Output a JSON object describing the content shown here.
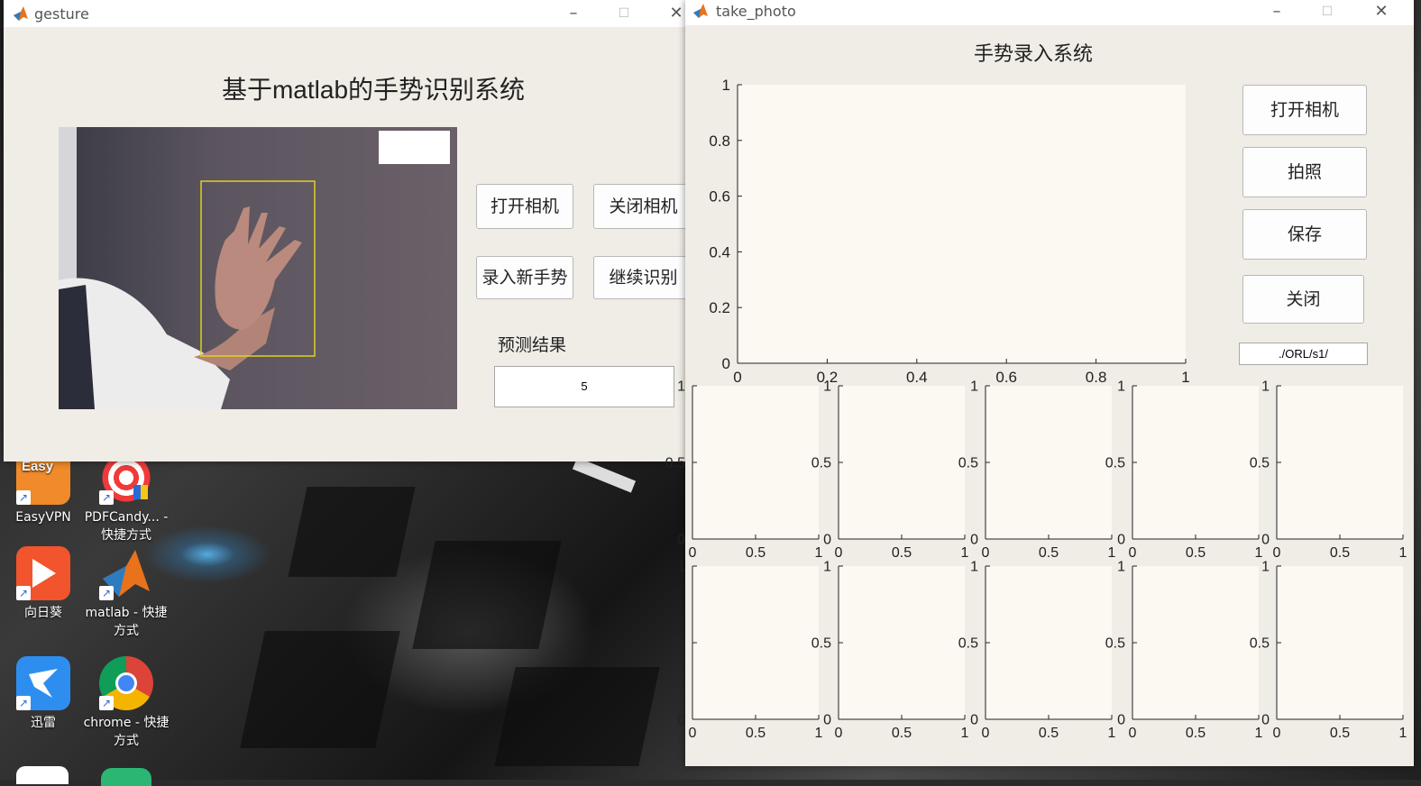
{
  "desktop": {
    "icons": [
      {
        "label": "EasyVPN",
        "badge": "Easy",
        "color": "#f08a2a",
        "icon": "easyvpn-icon"
      },
      {
        "label": "PDFCandy... - 快捷方式",
        "color": "#ffffff",
        "icon": "pdfcandy-icon"
      },
      {
        "label": "向日葵",
        "color": "#f2542d",
        "icon": "sunflower-icon"
      },
      {
        "label": "matlab - 快捷方式",
        "color": "#e8731c",
        "icon": "matlab-icon"
      },
      {
        "label": "迅雷",
        "color": "#2e8ef0",
        "icon": "thunder-icon"
      },
      {
        "label": "chrome - 快捷方式",
        "color": "#ffffff",
        "icon": "chrome-icon"
      }
    ]
  },
  "gesture_window": {
    "title": "gesture",
    "heading": "基于matlab的手势识别系统",
    "buttons": {
      "open_camera": "打开相机",
      "close_camera": "关闭相机",
      "record_new_gesture": "录入新手势",
      "continue_recognition": "继续识别"
    },
    "prediction_label": "预测结果",
    "prediction_value": "5"
  },
  "take_photo_window": {
    "title": "take_photo",
    "heading": "手势录入系统",
    "buttons": {
      "open_camera": "打开相机",
      "take_photo": "拍照",
      "save": "保存",
      "close": "关闭"
    },
    "path_value": "./ORL/s1/"
  },
  "chart_data": [
    {
      "type": "scatter",
      "name": "main-axes",
      "x": [],
      "y": [],
      "xlim": [
        0,
        1
      ],
      "ylim": [
        0,
        1
      ],
      "xticks": [
        "0",
        "0.2",
        "0.4",
        "0.6",
        "0.8",
        "1"
      ],
      "yticks": [
        "0",
        "0.2",
        "0.4",
        "0.6",
        "0.8",
        "1"
      ]
    },
    {
      "type": "scatter",
      "name": "thumbnail-axes-grid",
      "rows": 2,
      "cols": 5,
      "xlim": [
        0,
        1
      ],
      "ylim": [
        0,
        1
      ],
      "xticks": [
        "0",
        "0.5",
        "1"
      ],
      "yticks": [
        "0",
        "0.5",
        "1"
      ]
    }
  ]
}
